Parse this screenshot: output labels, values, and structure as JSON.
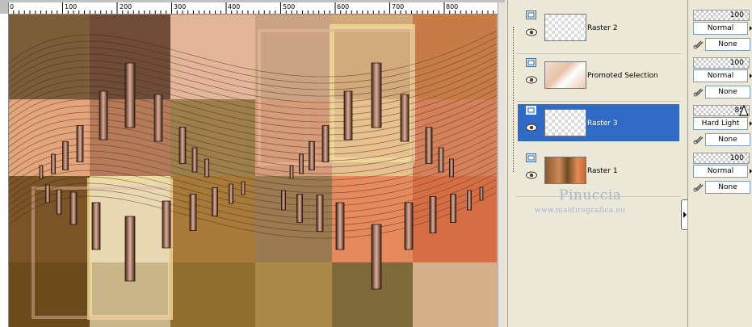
{
  "ruler": {
    "labels": [
      "0",
      "100",
      "200",
      "300",
      "400",
      "500",
      "600",
      "700",
      "800"
    ]
  },
  "layers": [
    {
      "name": "Raster 2",
      "selected": false
    },
    {
      "name": "Promoted Selection",
      "selected": false
    },
    {
      "name": "Raster 3",
      "selected": true
    },
    {
      "name": "Raster 1",
      "selected": false
    }
  ],
  "properties": [
    {
      "opacity": "100",
      "blend": "Normal",
      "mask": "None"
    },
    {
      "opacity": "100",
      "blend": "Normal",
      "mask": "None"
    },
    {
      "opacity": "85",
      "blend": "Hard Light",
      "mask": "None"
    },
    {
      "opacity": "100",
      "blend": "Normal",
      "mask": "None"
    }
  ],
  "watermark": {
    "name": "Pinuccia",
    "url": "www.maidiregrafica.eu"
  },
  "colors": {
    "selection": "#316ac5",
    "panel": "#ece9d8"
  }
}
